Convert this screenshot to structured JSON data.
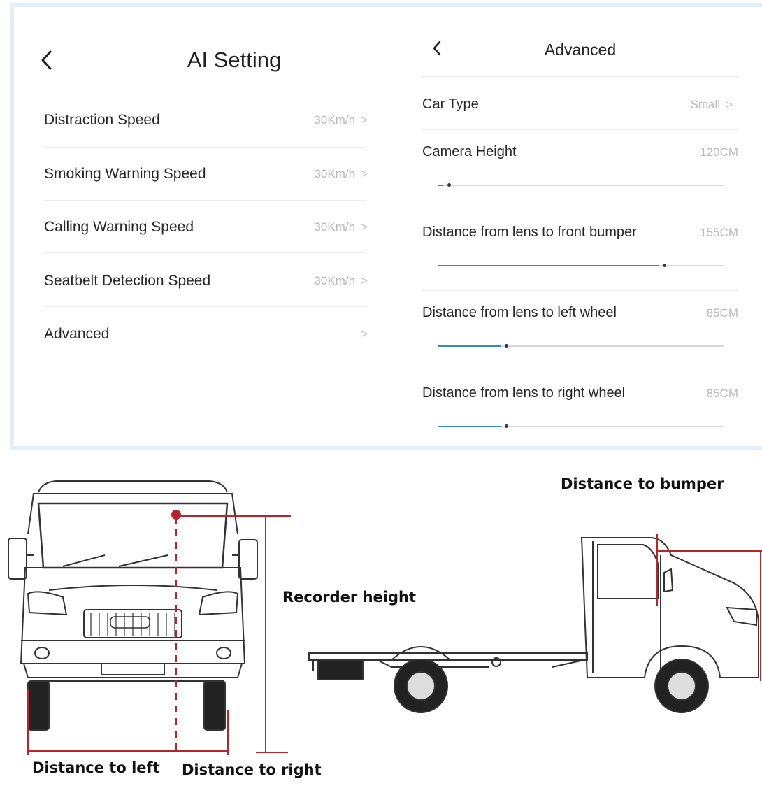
{
  "left_panel": {
    "title": "AI Setting",
    "items": [
      {
        "label": "Distraction Speed",
        "value": "30Km/h"
      },
      {
        "label": "Smoking Warning Speed",
        "value": "30Km/h"
      },
      {
        "label": "Calling Warning Speed",
        "value": "30Km/h"
      },
      {
        "label": "Seatbelt Detection Speed",
        "value": "30Km/h"
      },
      {
        "label": "Advanced",
        "value": ""
      }
    ]
  },
  "right_panel": {
    "title": "Advanced",
    "car_type": {
      "label": "Car Type",
      "value": "Small"
    },
    "sliders": [
      {
        "label": "Camera Height",
        "value": "120CM",
        "fill": 0.02
      },
      {
        "label": "Distance from lens to front bumper",
        "value": "155CM",
        "fill": 0.77
      },
      {
        "label": "Distance from lens to left wheel",
        "value": "85CM",
        "fill": 0.22
      },
      {
        "label": "Distance from lens to right wheel",
        "value": "85CM",
        "fill": 0.22
      }
    ]
  },
  "diagram": {
    "recorder_height": "Recorder height",
    "distance_to_left": "Distance to left",
    "distance_to_right": "Distance to right",
    "distance_to_bumper": "Distance to bumper"
  },
  "colors": {
    "accent": "#3b84d6",
    "measure_line": "#b3262e",
    "muted_text": "#b9b9b9"
  }
}
